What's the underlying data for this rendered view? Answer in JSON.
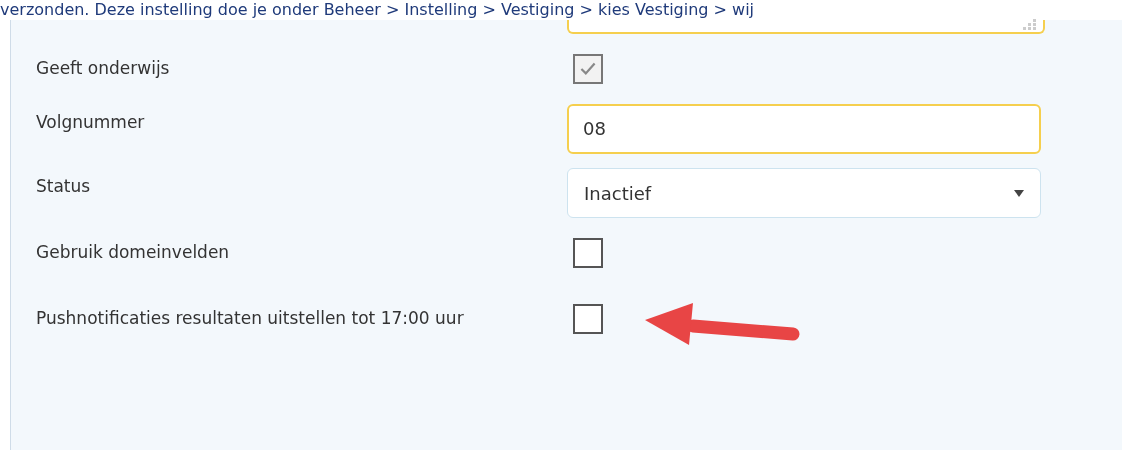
{
  "intro_text": "verzonden. Deze instelling doe je onder Beheer > Instelling > Vestiging > kies Vestiging > wij",
  "fields": [
    {
      "kind": "textarea"
    },
    {
      "kind": "checkbox",
      "label": "Geeft onderwijs",
      "checked": true,
      "disabled": true
    },
    {
      "kind": "text",
      "label": "Volgnummer",
      "value": "08"
    },
    {
      "kind": "select",
      "label": "Status",
      "value": "Inactief"
    },
    {
      "kind": "checkbox",
      "label": "Gebruik domeinvelden",
      "checked": false,
      "disabled": false
    },
    {
      "kind": "checkbox",
      "label": "Pushnotificaties resultaten uitstellen tot 17:00 uur",
      "checked": false,
      "disabled": false,
      "annotated": true
    }
  ]
}
